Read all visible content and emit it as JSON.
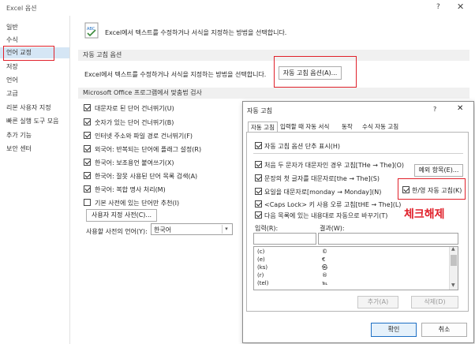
{
  "window": {
    "title": "Excel 옵션",
    "help": "?",
    "close": "✕"
  },
  "sidebar": {
    "items": [
      {
        "label": "일반"
      },
      {
        "label": "수식"
      },
      {
        "label": "언어 교정"
      },
      {
        "label": "저장"
      },
      {
        "label": "언어"
      },
      {
        "label": "고급"
      },
      {
        "label": "리본 사용자 지정"
      },
      {
        "label": "빠른 실행 도구 모음"
      },
      {
        "label": "추가 기능"
      },
      {
        "label": "보안 센터"
      }
    ],
    "selected_index": 2
  },
  "main": {
    "header_text": "Excel에서 텍스트를 수정하거나 서식을 지정하는 방법을 선택합니다.",
    "autocorrect_section": {
      "title": "자동 고침 옵션",
      "description": "Excel에서 텍스트를 수정하거나 서식을 지정하는 방법을 선택합니다.",
      "button": "자동 고침 옵션(A)..."
    },
    "spelling_section": {
      "title": "Microsoft Office 프로그램에서 맞춤법 검사",
      "options": [
        {
          "label": "대문자로 된 단어 건너뛰기(U)",
          "checked": true
        },
        {
          "label": "숫자가 있는 단어 건너뛰기(B)",
          "checked": true
        },
        {
          "label": "인터넷 주소와 파일 경로 건너뛰기(F)",
          "checked": true
        },
        {
          "label": "외국어: 반복되는 단어에 플래그 설정(R)",
          "checked": true
        },
        {
          "label": "한국어: 보조용언 붙여쓰기(X)",
          "checked": true
        },
        {
          "label": "한국어: 잘못 사용된 단어 목록 검색(A)",
          "checked": true
        },
        {
          "label": "한국어: 복합 명사 처리(M)",
          "checked": true
        },
        {
          "label": "기본 사전에 있는 단어만 추천(I)",
          "checked": false
        }
      ],
      "custom_dict_button": "사용자 지정 사전(C)...",
      "dict_language_label": "사용할 사전의 언어(Y):",
      "dict_language_value": "한국어"
    }
  },
  "dialog": {
    "title": "자동 고침",
    "help": "?",
    "close": "✕",
    "tabs": [
      {
        "label": "자동 고침"
      },
      {
        "label": "입력할 때 자동 서식"
      },
      {
        "label": "동작"
      },
      {
        "label": "수식 자동 고침"
      }
    ],
    "show_buttons": {
      "label": "자동 고침 옵션 단추 표시(H)",
      "checked": true
    },
    "options": [
      {
        "label": "처음 두 문자가 대문자인 경우 고침[THe → The](O)",
        "checked": true
      },
      {
        "label": "문장의 첫 글자를 대문자로[the → The](S)",
        "checked": true
      },
      {
        "label": "요일을 대문자로[monday → Monday](N)",
        "checked": true
      },
      {
        "label": "<Caps Lock> 키 사용 오류 고침[tHE → The](L)",
        "checked": true
      },
      {
        "label": "다음 목록에 있는 내용대로 자동으로 바꾸기(T)",
        "checked": true
      }
    ],
    "exceptions_button": "예외 항목(E)...",
    "hanyoung": {
      "label": "한/영 자동 고침(K)",
      "checked": true
    },
    "annotation": "체크해제",
    "input_label": "입력(R):",
    "result_label": "결과(W):",
    "entries": [
      {
        "input": "(c)",
        "result": "©"
      },
      {
        "input": "(e)",
        "result": "€"
      },
      {
        "input": "(ks)",
        "result": "㉿"
      },
      {
        "input": "(r)",
        "result": "®"
      },
      {
        "input": "(tel)",
        "result": "℡"
      }
    ],
    "add_button": "추가(A)",
    "delete_button": "삭제(D)",
    "ok_button": "확인",
    "cancel_button": "취소"
  },
  "colors": {
    "highlight_red": "#e0202a",
    "selected_bg": "#d5e6f5",
    "accent_blue": "#1e6fc4"
  }
}
